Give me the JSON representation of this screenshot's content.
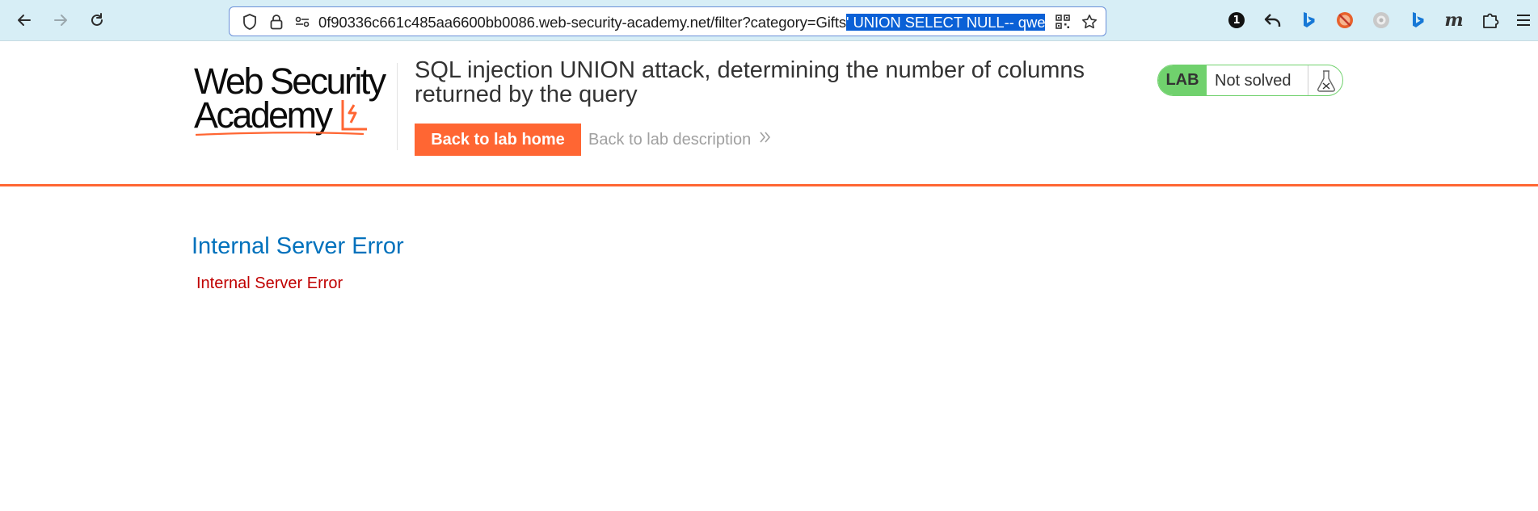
{
  "browser": {
    "url_prefix": "0f90336c661c485aa6600bb0086.web-security-academy.net/filter?category=Gifts",
    "url_selected": "' UNION SELECT NULL-- qwe",
    "icons": [
      "back-icon",
      "forward-icon",
      "reload-icon",
      "shield-icon",
      "lock-icon",
      "permissions-icon",
      "qr-code-icon",
      "bookmark-star-icon"
    ],
    "extensions": [
      "password-manager-icon",
      "undo-arrow-icon",
      "bing-icon",
      "blocked-extension-icon",
      "grey-extension-icon",
      "bing-icon-2",
      "m-extension-icon",
      "extensions-puzzle-icon",
      "menu-icon"
    ],
    "ext_badge": "1",
    "ext_m": "m"
  },
  "header": {
    "logo_line1": "Web Security",
    "logo_line2": "Academy",
    "title": "SQL injection UNION attack, determining the number of columns returned by the query",
    "back_home": "Back to lab home",
    "back_desc": "Back to lab description",
    "lab_tag": "LAB",
    "lab_status": "Not solved",
    "colors": {
      "accent": "#ff6633",
      "lab_green": "#70d16d",
      "link_blue": "#0071bc",
      "error_red": "#c00000"
    }
  },
  "main": {
    "error_title": "Internal Server Error",
    "error_message": "Internal Server Error"
  }
}
